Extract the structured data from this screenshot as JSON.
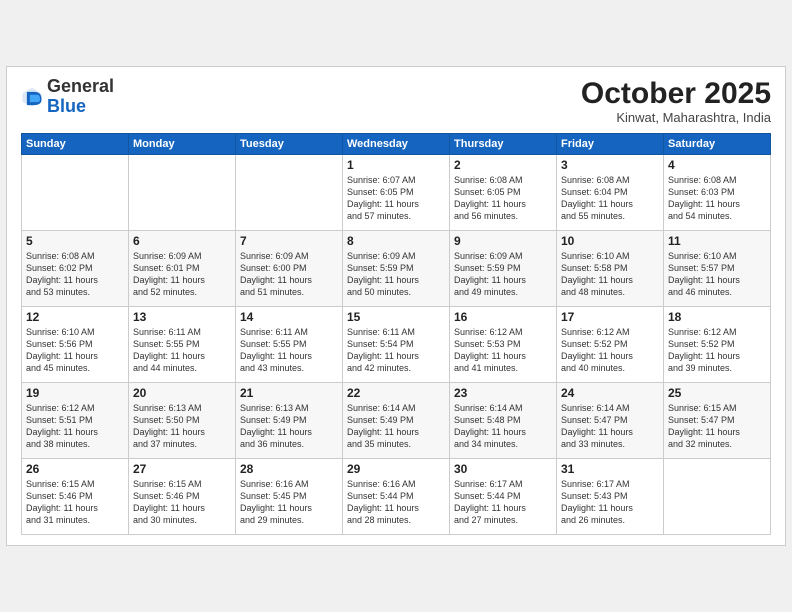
{
  "header": {
    "logo_line1": "General",
    "logo_line2": "Blue",
    "month_title": "October 2025",
    "subtitle": "Kinwat, Maharashtra, India"
  },
  "weekdays": [
    "Sunday",
    "Monday",
    "Tuesday",
    "Wednesday",
    "Thursday",
    "Friday",
    "Saturday"
  ],
  "weeks": [
    [
      {
        "day": "",
        "info": ""
      },
      {
        "day": "",
        "info": ""
      },
      {
        "day": "",
        "info": ""
      },
      {
        "day": "1",
        "info": "Sunrise: 6:07 AM\nSunset: 6:05 PM\nDaylight: 11 hours\nand 57 minutes."
      },
      {
        "day": "2",
        "info": "Sunrise: 6:08 AM\nSunset: 6:05 PM\nDaylight: 11 hours\nand 56 minutes."
      },
      {
        "day": "3",
        "info": "Sunrise: 6:08 AM\nSunset: 6:04 PM\nDaylight: 11 hours\nand 55 minutes."
      },
      {
        "day": "4",
        "info": "Sunrise: 6:08 AM\nSunset: 6:03 PM\nDaylight: 11 hours\nand 54 minutes."
      }
    ],
    [
      {
        "day": "5",
        "info": "Sunrise: 6:08 AM\nSunset: 6:02 PM\nDaylight: 11 hours\nand 53 minutes."
      },
      {
        "day": "6",
        "info": "Sunrise: 6:09 AM\nSunset: 6:01 PM\nDaylight: 11 hours\nand 52 minutes."
      },
      {
        "day": "7",
        "info": "Sunrise: 6:09 AM\nSunset: 6:00 PM\nDaylight: 11 hours\nand 51 minutes."
      },
      {
        "day": "8",
        "info": "Sunrise: 6:09 AM\nSunset: 5:59 PM\nDaylight: 11 hours\nand 50 minutes."
      },
      {
        "day": "9",
        "info": "Sunrise: 6:09 AM\nSunset: 5:59 PM\nDaylight: 11 hours\nand 49 minutes."
      },
      {
        "day": "10",
        "info": "Sunrise: 6:10 AM\nSunset: 5:58 PM\nDaylight: 11 hours\nand 48 minutes."
      },
      {
        "day": "11",
        "info": "Sunrise: 6:10 AM\nSunset: 5:57 PM\nDaylight: 11 hours\nand 46 minutes."
      }
    ],
    [
      {
        "day": "12",
        "info": "Sunrise: 6:10 AM\nSunset: 5:56 PM\nDaylight: 11 hours\nand 45 minutes."
      },
      {
        "day": "13",
        "info": "Sunrise: 6:11 AM\nSunset: 5:55 PM\nDaylight: 11 hours\nand 44 minutes."
      },
      {
        "day": "14",
        "info": "Sunrise: 6:11 AM\nSunset: 5:55 PM\nDaylight: 11 hours\nand 43 minutes."
      },
      {
        "day": "15",
        "info": "Sunrise: 6:11 AM\nSunset: 5:54 PM\nDaylight: 11 hours\nand 42 minutes."
      },
      {
        "day": "16",
        "info": "Sunrise: 6:12 AM\nSunset: 5:53 PM\nDaylight: 11 hours\nand 41 minutes."
      },
      {
        "day": "17",
        "info": "Sunrise: 6:12 AM\nSunset: 5:52 PM\nDaylight: 11 hours\nand 40 minutes."
      },
      {
        "day": "18",
        "info": "Sunrise: 6:12 AM\nSunset: 5:52 PM\nDaylight: 11 hours\nand 39 minutes."
      }
    ],
    [
      {
        "day": "19",
        "info": "Sunrise: 6:12 AM\nSunset: 5:51 PM\nDaylight: 11 hours\nand 38 minutes."
      },
      {
        "day": "20",
        "info": "Sunrise: 6:13 AM\nSunset: 5:50 PM\nDaylight: 11 hours\nand 37 minutes."
      },
      {
        "day": "21",
        "info": "Sunrise: 6:13 AM\nSunset: 5:49 PM\nDaylight: 11 hours\nand 36 minutes."
      },
      {
        "day": "22",
        "info": "Sunrise: 6:14 AM\nSunset: 5:49 PM\nDaylight: 11 hours\nand 35 minutes."
      },
      {
        "day": "23",
        "info": "Sunrise: 6:14 AM\nSunset: 5:48 PM\nDaylight: 11 hours\nand 34 minutes."
      },
      {
        "day": "24",
        "info": "Sunrise: 6:14 AM\nSunset: 5:47 PM\nDaylight: 11 hours\nand 33 minutes."
      },
      {
        "day": "25",
        "info": "Sunrise: 6:15 AM\nSunset: 5:47 PM\nDaylight: 11 hours\nand 32 minutes."
      }
    ],
    [
      {
        "day": "26",
        "info": "Sunrise: 6:15 AM\nSunset: 5:46 PM\nDaylight: 11 hours\nand 31 minutes."
      },
      {
        "day": "27",
        "info": "Sunrise: 6:15 AM\nSunset: 5:46 PM\nDaylight: 11 hours\nand 30 minutes."
      },
      {
        "day": "28",
        "info": "Sunrise: 6:16 AM\nSunset: 5:45 PM\nDaylight: 11 hours\nand 29 minutes."
      },
      {
        "day": "29",
        "info": "Sunrise: 6:16 AM\nSunset: 5:44 PM\nDaylight: 11 hours\nand 28 minutes."
      },
      {
        "day": "30",
        "info": "Sunrise: 6:17 AM\nSunset: 5:44 PM\nDaylight: 11 hours\nand 27 minutes."
      },
      {
        "day": "31",
        "info": "Sunrise: 6:17 AM\nSunset: 5:43 PM\nDaylight: 11 hours\nand 26 minutes."
      },
      {
        "day": "",
        "info": ""
      }
    ]
  ]
}
